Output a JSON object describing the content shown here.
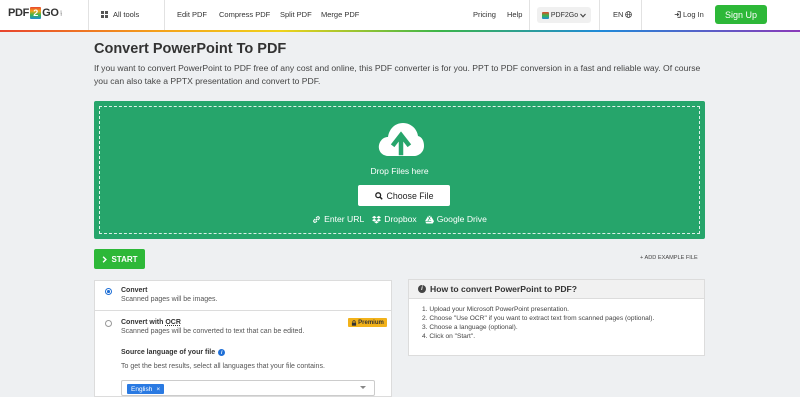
{
  "nav": {
    "logo_left": "PDF",
    "logo_mid": "2",
    "logo_right": "GO",
    "logo_suffix": ".com",
    "all_tools": "All tools",
    "links": [
      "Edit PDF",
      "Compress PDF",
      "Split PDF",
      "Merge PDF"
    ],
    "pricing": "Pricing",
    "help": "Help",
    "brand_select": "PDF2Go",
    "language": "EN",
    "login": "Log In",
    "signup": "Sign Up"
  },
  "page": {
    "title": "Convert PowerPoint To PDF",
    "intro": "If you want to convert PowerPoint to PDF free of any cost and online, this PDF converter is for you. PPT to PDF conversion in a fast and reliable way. Of course you can also take a PPTX presentation and convert to PDF."
  },
  "upload": {
    "drop_text": "Drop Files here",
    "choose_file": "Choose File",
    "enter_url": "Enter URL",
    "dropbox": "Dropbox",
    "google_drive": "Google Drive"
  },
  "actions": {
    "start": "START",
    "add_example": "ADD EXAMPLE FILE"
  },
  "options": {
    "convert_title": "Convert",
    "convert_desc": "Scanned pages will be images.",
    "ocr_title_prefix": "Convert with ",
    "ocr_title_ocr": "OCR",
    "ocr_desc": "Scanned pages will be converted to text that can be edited.",
    "premium": "Premium",
    "language_label": "Source language of your file",
    "language_hint": "To get the best results, select all languages that your file contains.",
    "selected_language": "English",
    "convert_selected": true
  },
  "howto": {
    "title": "How to convert PowerPoint to PDF?",
    "steps": [
      "1. Upload your Microsoft PowerPoint presentation.",
      "2. Choose \"Use OCR\" if you want to extract text from scanned pages (optional).",
      "3. Choose a language (optional).",
      "4. Click on \"Start\"."
    ]
  },
  "colors": {
    "brand_green": "#2db838",
    "drop_green": "#26a56b",
    "premium_yellow": "#f2b21a",
    "tag_blue": "#2a7ae2"
  }
}
